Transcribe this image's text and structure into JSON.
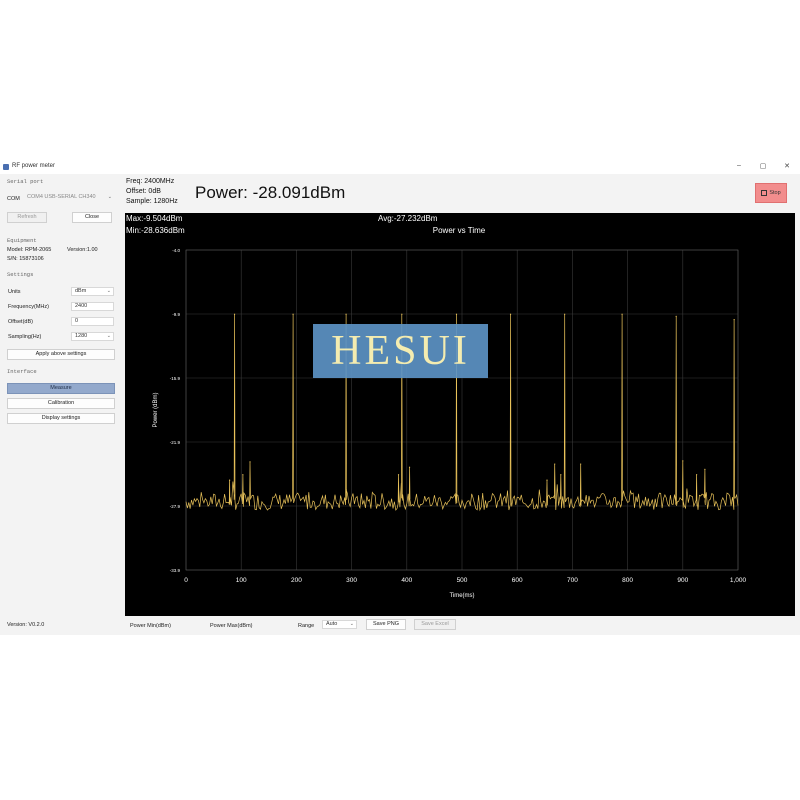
{
  "app": {
    "title": "RF power meter",
    "min": "–",
    "max": "▢",
    "close": "✕"
  },
  "serial": {
    "section": "Serial port",
    "com_label": "COM",
    "com_value": "COM4 USB-SERIAL CH340",
    "refresh": "Refresh",
    "close": "Close"
  },
  "equipment": {
    "section": "Equipment",
    "model": "Model: RPM-2065",
    "version": "Version:1.00",
    "sn": "S/N: 15873106"
  },
  "settings": {
    "section": "Settings",
    "units_label": "Units",
    "units_value": "dBm",
    "freq_label": "Frequency(MHz)",
    "freq_value": "2400",
    "offset_label": "Offset(dB)",
    "offset_value": "0",
    "sampling_label": "Sampling(Hz)",
    "sampling_value": "1280",
    "apply": "Apply above settings"
  },
  "interface": {
    "section": "Interface",
    "measure": "Measure",
    "calibration": "Calibration",
    "display": "Display settings"
  },
  "version": "Version: V0.2.0",
  "readout": {
    "freq": "Freq: 2400MHz",
    "offset": "Offset: 0dB",
    "sample": "Sample: 1280Hz",
    "power": "Power:  -28.091dBm",
    "max": "Max:-9.504dBm",
    "min": "Min:-28.636dBm",
    "avg": "Avg:-27.232dBm"
  },
  "stop": "Stop",
  "bottom": {
    "pmin": "Power Min(dBm)",
    "pmax": "Power Max(dBm)",
    "range_label": "Range",
    "range_value": "Auto",
    "save_png": "Save PNG",
    "save_excel": "Save Excel"
  },
  "watermark": "HESUI",
  "colors": {
    "trace": "#e8c25a",
    "plot_bg": "#000000",
    "grid": "#3a3a3a",
    "stop_bg": "#f28d8d",
    "active_btn": "#93a9cc"
  },
  "chart_data": {
    "type": "line",
    "title": "Power vs Time",
    "xlabel": "Time(ms)",
    "ylabel": "Power (dBm)",
    "xlim": [
      0,
      1000
    ],
    "ylim": [
      -33.9,
      -4.0
    ],
    "xticks": [
      "0",
      "100",
      "200",
      "300",
      "400",
      "500",
      "600",
      "700",
      "800",
      "900",
      "1,000"
    ],
    "yticks": [
      "-4.0",
      "-9.9",
      "-15.9",
      "-21.9",
      "-27.9",
      "-33.9"
    ],
    "grid": true,
    "baseline": -27.5,
    "spikes": [
      {
        "x": 79,
        "y": -25.5
      },
      {
        "x": 88,
        "y": -10.0
      },
      {
        "x": 103,
        "y": -25.0
      },
      {
        "x": 116,
        "y": -23.8
      },
      {
        "x": 194,
        "y": -10.0
      },
      {
        "x": 290,
        "y": -10.0
      },
      {
        "x": 385,
        "y": -25.0
      },
      {
        "x": 391,
        "y": -10.0
      },
      {
        "x": 405,
        "y": -24.3
      },
      {
        "x": 490,
        "y": -10.0
      },
      {
        "x": 588,
        "y": -10.0
      },
      {
        "x": 654,
        "y": -25.5
      },
      {
        "x": 668,
        "y": -24.0
      },
      {
        "x": 679,
        "y": -25.0
      },
      {
        "x": 686,
        "y": -10.0
      },
      {
        "x": 715,
        "y": -24.0
      },
      {
        "x": 790,
        "y": -10.0
      },
      {
        "x": 888,
        "y": -10.2
      },
      {
        "x": 900,
        "y": -23.7
      },
      {
        "x": 925,
        "y": -25.0
      },
      {
        "x": 940,
        "y": -24.5
      },
      {
        "x": 993,
        "y": -10.5
      }
    ]
  }
}
